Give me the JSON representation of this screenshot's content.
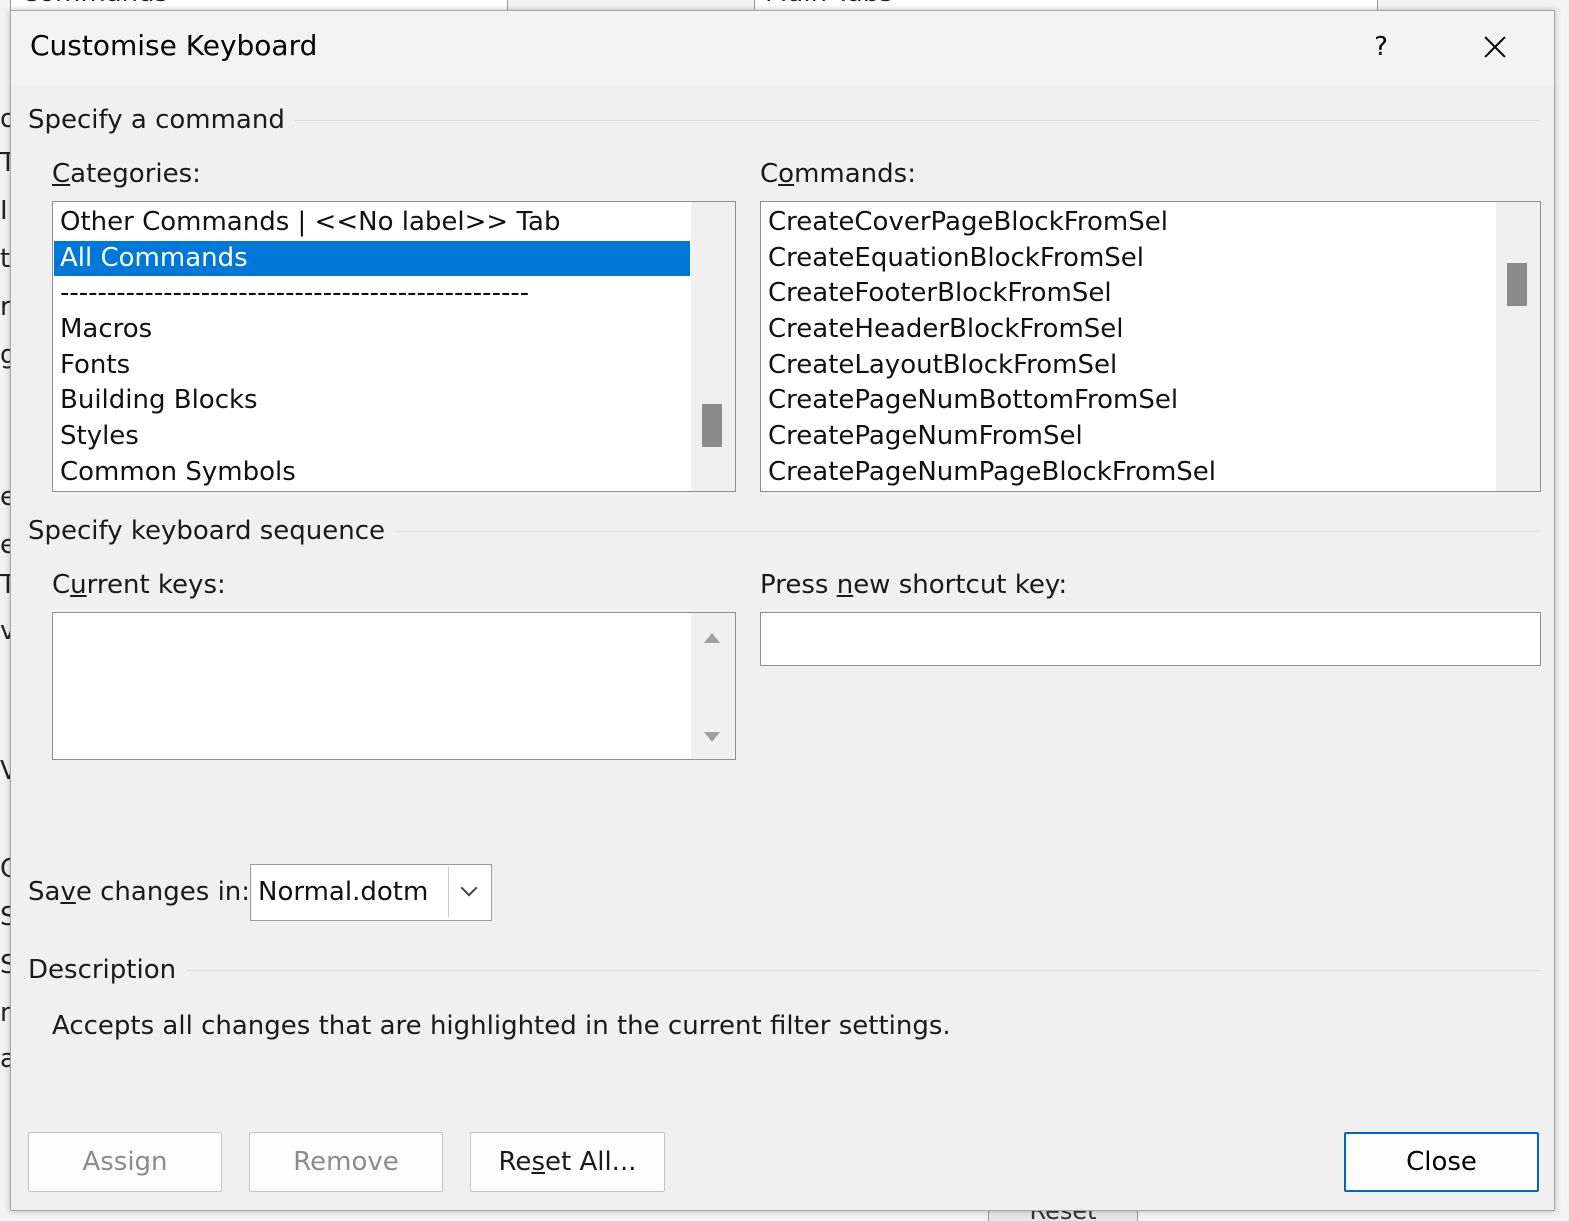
{
  "background": {
    "combo_left": "Commands",
    "combo_right": "Main Tabs",
    "fragments": [
      "o",
      "Ta",
      "I",
      "ts",
      "re",
      "g",
      "e",
      "e",
      "T",
      "v",
      "V",
      "C",
      "S",
      "S",
      "n",
      "a"
    ],
    "reset_button": "Reset"
  },
  "dialog": {
    "title": "Customise Keyboard",
    "help": "?",
    "specify_command": {
      "section_title": "Specify a command",
      "categories_label_pre": "",
      "categories_label_u": "C",
      "categories_label_post": "ategories:",
      "categories": [
        "Other Commands | <<No label>> Tab",
        "All Commands",
        "--------------------------------------------------",
        "Macros",
        "Fonts",
        "Building Blocks",
        "Styles",
        "Common Symbols"
      ],
      "selected_category": "All Commands",
      "commands_label_pre": "C",
      "commands_label_u": "o",
      "commands_label_post": "mmands:",
      "commands": [
        "CreateCoverPageBlockFromSel",
        "CreateEquationBlockFromSel",
        "CreateFooterBlockFromSel",
        "CreateHeaderBlockFromSel",
        "CreateLayoutBlockFromSel",
        "CreatePageNumBottomFromSel",
        "CreatePageNumFromSel",
        "CreatePageNumPageBlockFromSel"
      ]
    },
    "keyboard_sequence": {
      "section_title": "Specify keyboard sequence",
      "current_keys_label_pre": "C",
      "current_keys_label_u": "u",
      "current_keys_label_post": "rrent keys:",
      "new_key_label_pre": "Press ",
      "new_key_label_u": "n",
      "new_key_label_post": "ew shortcut key:",
      "new_key_value": ""
    },
    "save_changes": {
      "label_pre": "Sa",
      "label_u": "v",
      "label_post": "e changes in:",
      "value": "Normal.dotm"
    },
    "description": {
      "section_title": "Description",
      "text": "Accepts all changes that are highlighted in the current filter settings."
    },
    "buttons": {
      "assign": "Assign",
      "remove": "Remove",
      "reset_pre": "Re",
      "reset_u": "s",
      "reset_post": "et All...",
      "close": "Close"
    },
    "colors": {
      "selection": "#0078d7",
      "default_button_border": "#0067c0"
    }
  }
}
